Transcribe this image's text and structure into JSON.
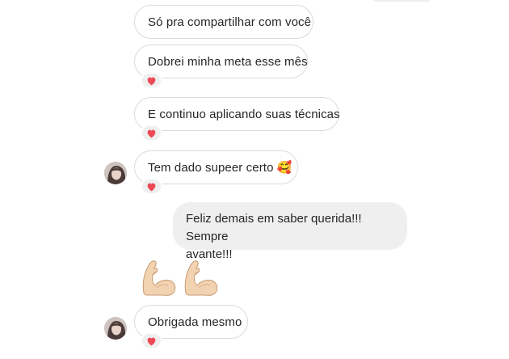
{
  "conversation": {
    "messages": [
      {
        "side": "incoming",
        "text": "Só pra compartilhar com você",
        "reaction": null
      },
      {
        "side": "incoming",
        "text": "Dobrei minha meta esse mês",
        "reaction": "heart-icon"
      },
      {
        "side": "incoming",
        "text": "E continuo aplicando suas técnicas",
        "reaction": "heart-icon"
      },
      {
        "side": "incoming",
        "text": "Tem dado supeer certo 🥰",
        "reaction": "heart-icon",
        "avatar": true
      },
      {
        "side": "outgoing",
        "text_line1": "Feliz demais em saber querida!!! Sempre",
        "text_line2": "avante!!!"
      },
      {
        "side": "outgoing",
        "emoji": [
          "flexed-biceps-icon",
          "flexed-biceps-icon"
        ]
      },
      {
        "side": "incoming",
        "text": "Obrigada mesmo",
        "reaction": "heart-icon",
        "avatar": true
      }
    ]
  },
  "colors": {
    "incoming_bubble_border": "#dbdbdb",
    "outgoing_bubble_bg": "#efefef",
    "reaction_bg": "#efefef",
    "heart": "#ed4956",
    "text": "#262626"
  }
}
